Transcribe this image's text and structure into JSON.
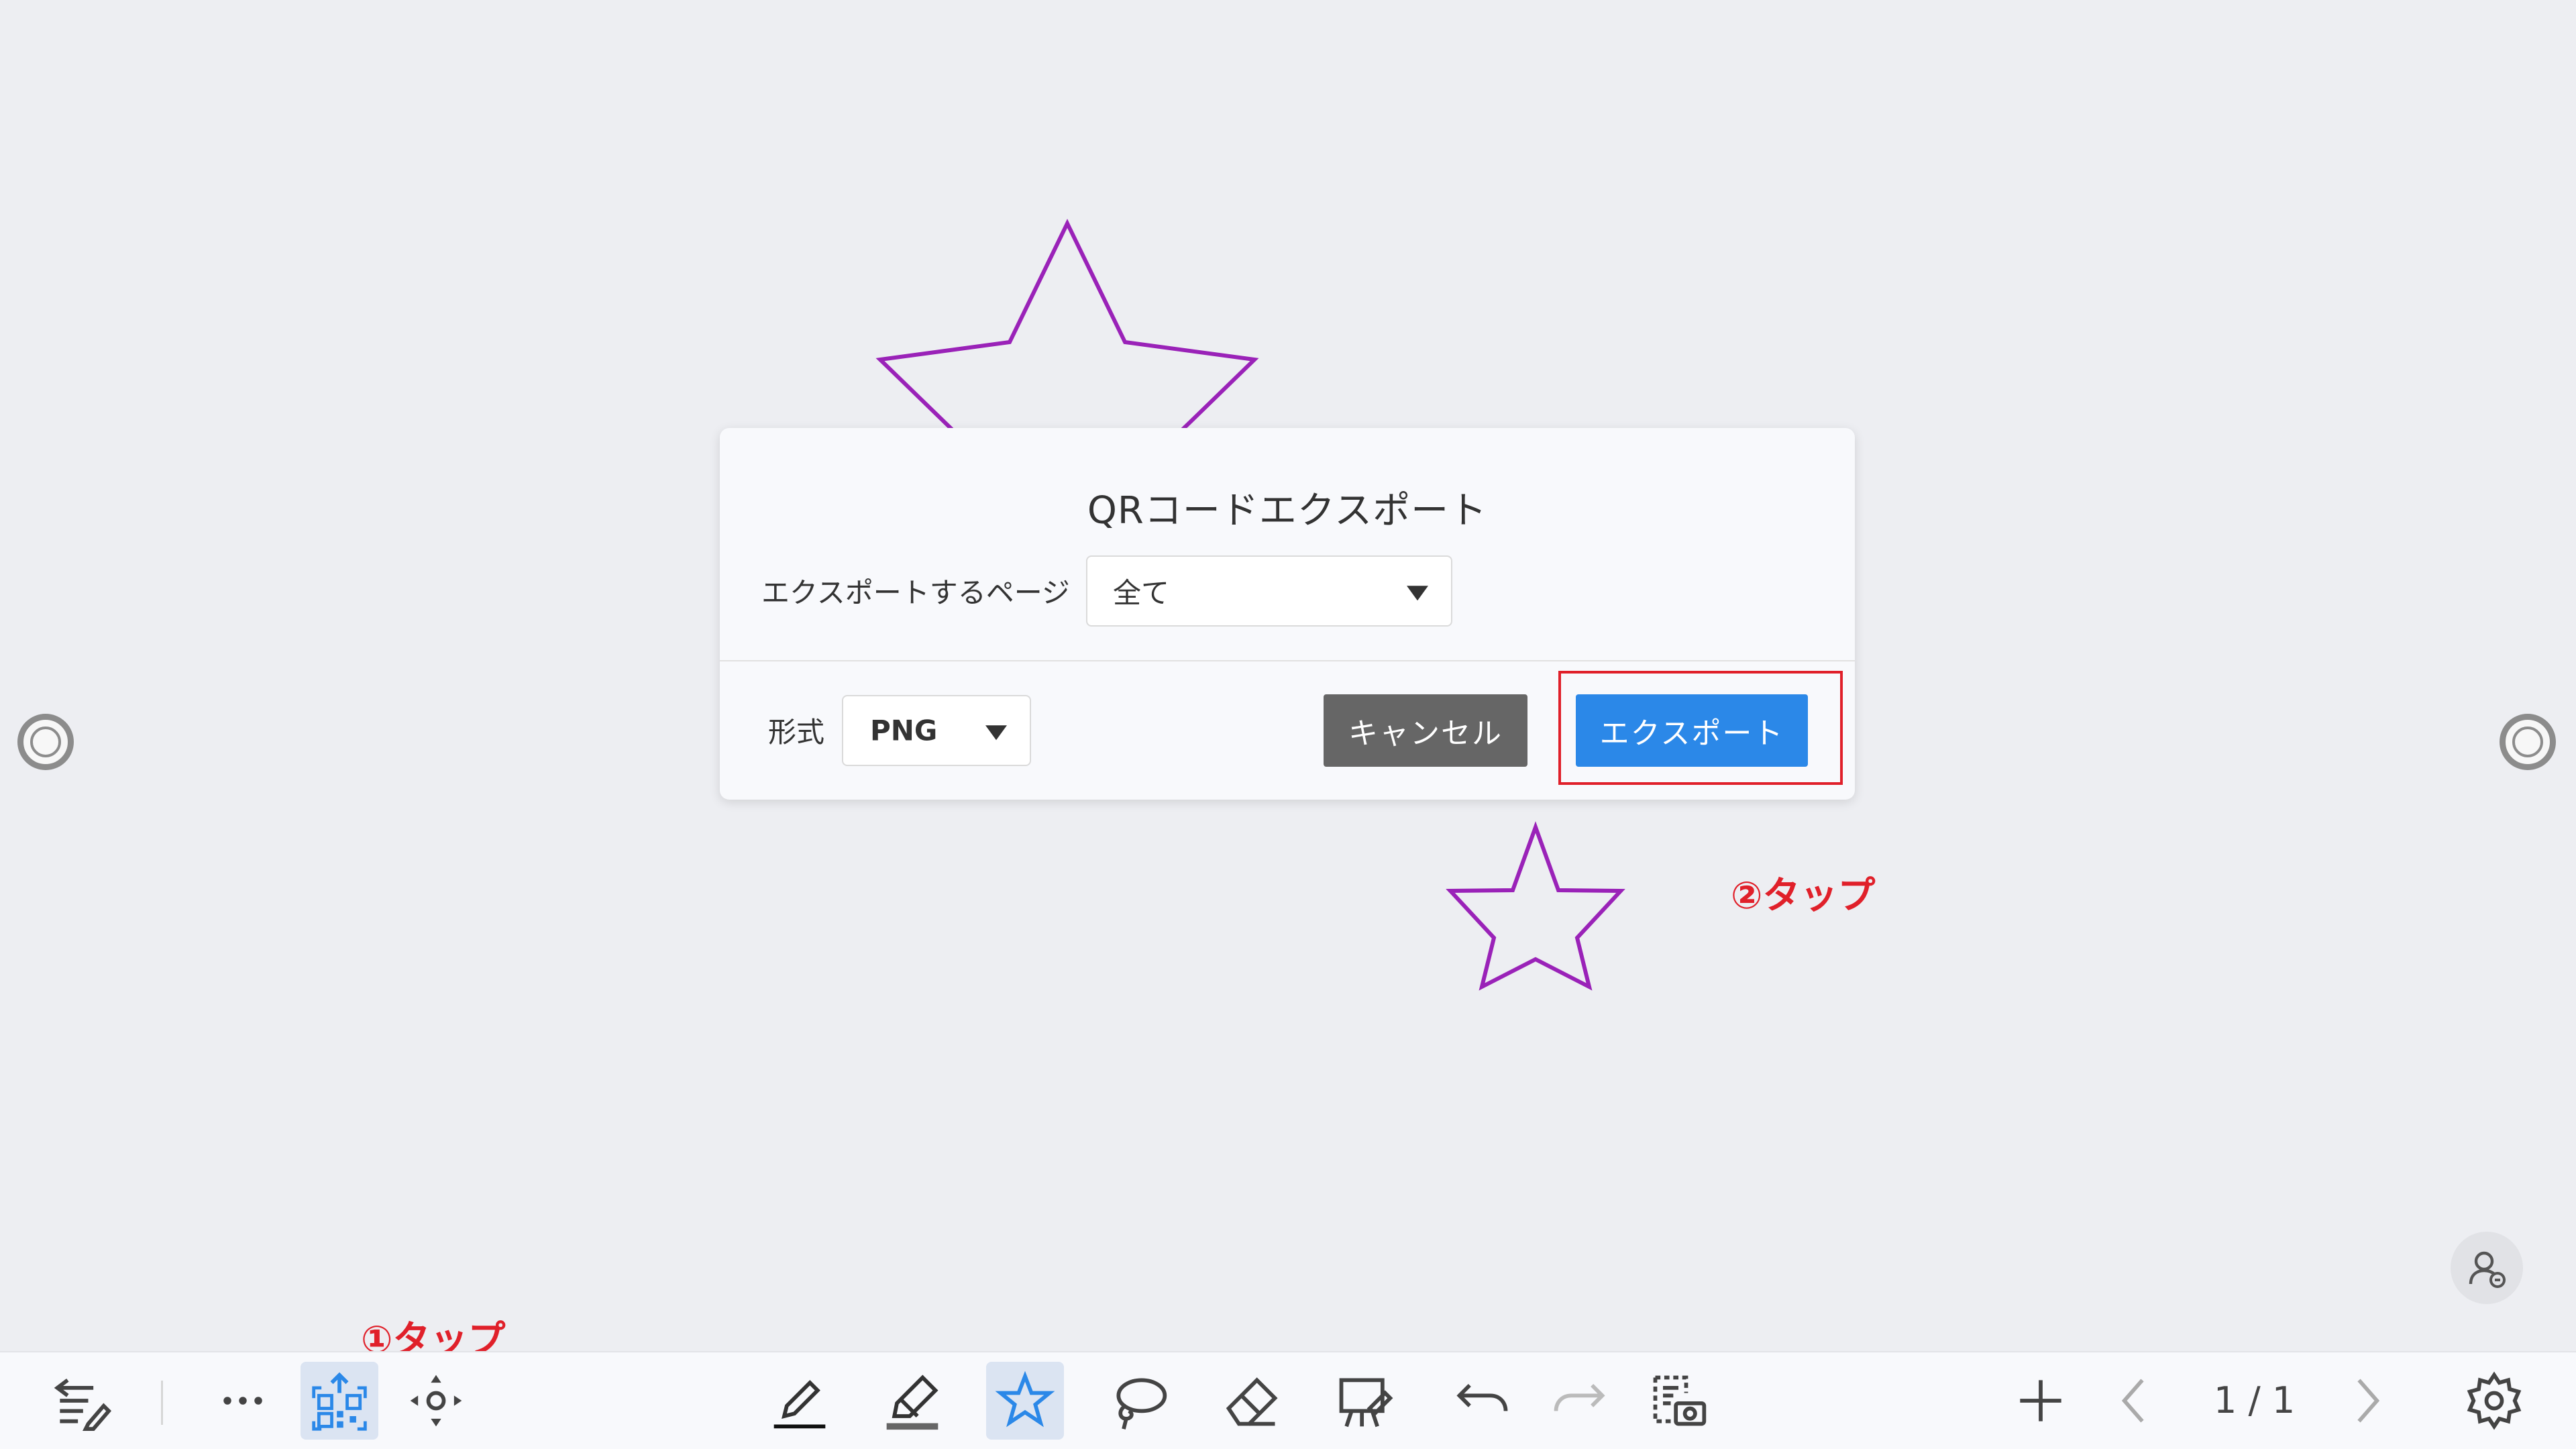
{
  "dialog": {
    "title": "QRコードエクスポート",
    "page_label": "エクスポートするページ",
    "page_select_value": "全て",
    "format_label": "形式",
    "format_value": "PNG",
    "cancel_label": "キャンセル",
    "export_label": "エクスポート"
  },
  "annotations": {
    "step1": "①タップ",
    "step2": "②タップ"
  },
  "toolbar": {
    "page_indicator": "1 / 1"
  },
  "colors": {
    "primary": "#2b88e8",
    "cancel": "#666666",
    "annotation": "#e0202a",
    "star_stroke": "#9a22b8",
    "active_tool": "#2b88e8"
  },
  "icons": [
    "notes-return-icon",
    "more-icon",
    "qr-export-icon",
    "move-icon",
    "pen-icon",
    "highlighter-icon",
    "star-shape-icon",
    "lasso-icon",
    "eraser-icon",
    "presentation-icon",
    "undo-icon",
    "redo-icon",
    "screenshot-icon",
    "add-page-icon",
    "prev-page-icon",
    "next-page-icon",
    "settings-icon",
    "user-switch-icon"
  ]
}
